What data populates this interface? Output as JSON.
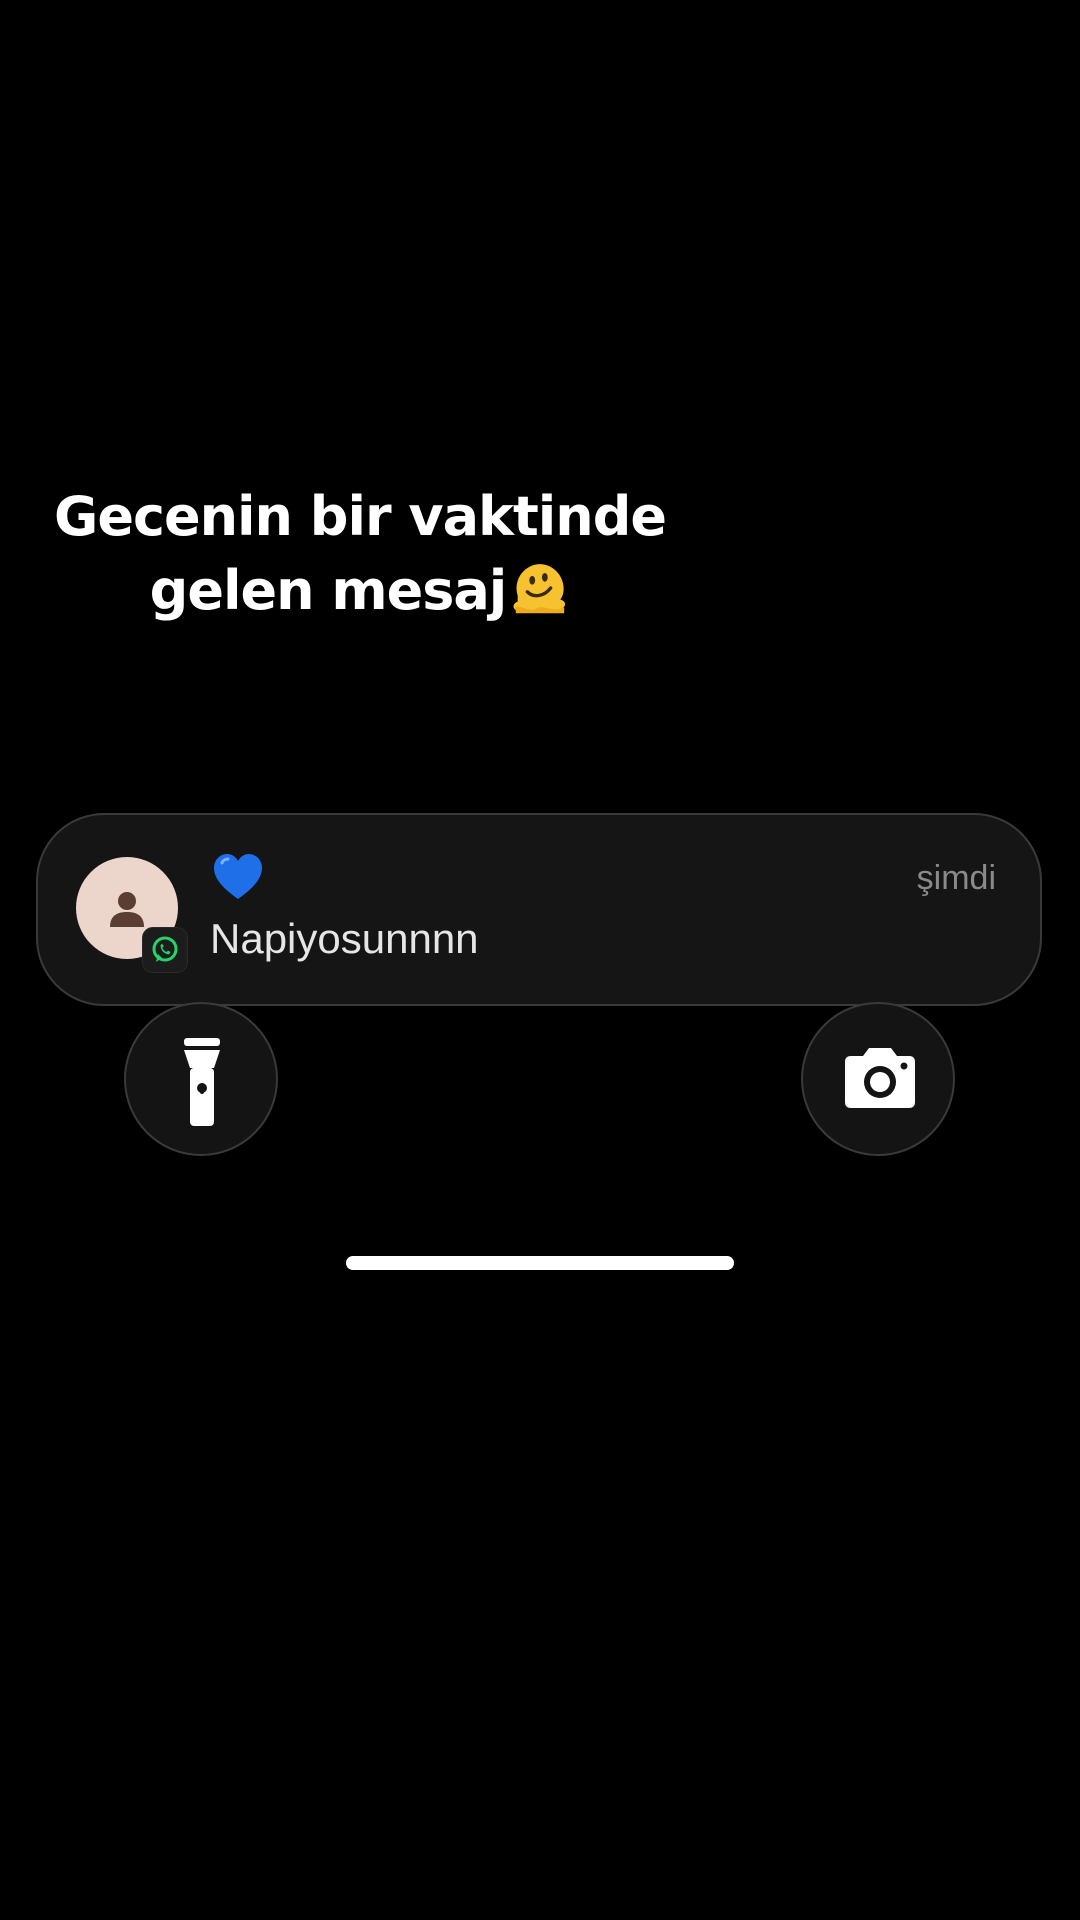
{
  "caption": {
    "line1": "Gecenin bir vaktinde",
    "line2": "gelen mesaj",
    "emoji": "melting-face-emoji"
  },
  "notification": {
    "sender": "💙",
    "time": "şimdi",
    "message": "Napiyosunnnn",
    "app_icon": "whatsapp-icon",
    "avatar_icon": "person-icon"
  },
  "quick_actions": {
    "flashlight_icon": "flashlight-icon",
    "camera_icon": "camera-icon"
  },
  "colors": {
    "background": "#000000",
    "notification_bg": "#151515",
    "avatar_bg": "#ecd5cb",
    "whatsapp_green": "#25d366",
    "sender_heart": "#1e6fe8",
    "time_text": "#8a8a8a"
  }
}
